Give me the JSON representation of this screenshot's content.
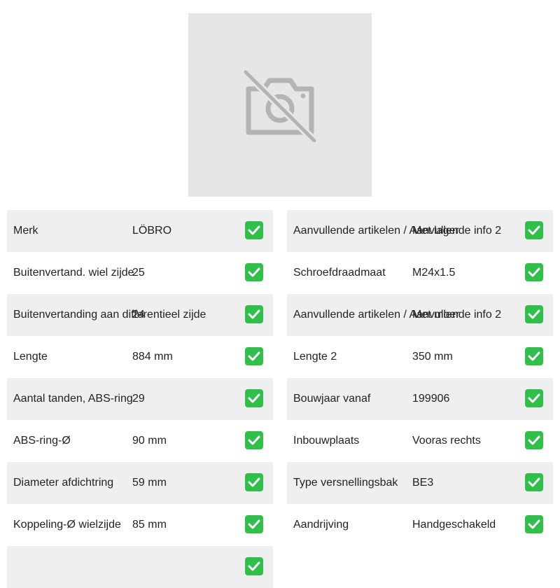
{
  "product_image": {
    "icon": "no-camera-icon"
  },
  "left_specs": [
    {
      "label": "Merk",
      "value": "LÖBRO"
    },
    {
      "label": "Buitenvertand. wiel zijde",
      "value": "25"
    },
    {
      "label": "Buitenvertanding aan differentieel zijde",
      "value": "24"
    },
    {
      "label": "Lengte",
      "value": "884 mm"
    },
    {
      "label": "Aantal tanden, ABS-ring",
      "value": "29"
    },
    {
      "label": "ABS-ring-Ø",
      "value": "90 mm"
    },
    {
      "label": "Diameter afdichtring",
      "value": "59 mm"
    },
    {
      "label": "Koppeling-Ø wielzijde",
      "value": "85 mm"
    },
    {
      "label": "",
      "value": ""
    }
  ],
  "right_specs": [
    {
      "label": "Aanvullende artikelen / Aanvullende info 2",
      "value": "Met lager"
    },
    {
      "label": "Schroefdraadmaat",
      "value": "M24x1.5"
    },
    {
      "label": "Aanvullende artikelen / Aanvullende info 2",
      "value": "Met moer"
    },
    {
      "label": "Lengte 2",
      "value": "350 mm"
    },
    {
      "label": "Bouwjaar vanaf",
      "value": "199906"
    },
    {
      "label": "Inbouwplaats",
      "value": "Vooras rechts"
    },
    {
      "label": "Type versnellingsbak",
      "value": "BE3"
    },
    {
      "label": "Aandrijving",
      "value": "Handgeschakeld"
    }
  ],
  "colors": {
    "row_shade": "#efefef",
    "check_green": "#2fbf4a",
    "image_bg": "#e6e6e6"
  }
}
